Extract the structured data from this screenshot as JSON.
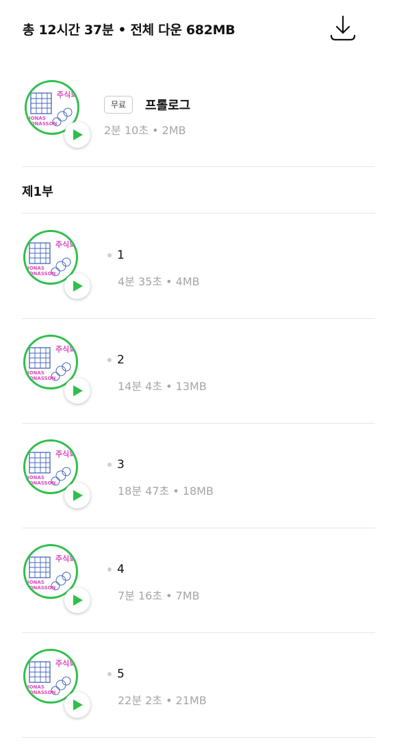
{
  "summary": {
    "text": "총 12시간 37분 • 전체 다운 682MB",
    "download_icon": "download-icon"
  },
  "prologue": {
    "badge": "무료",
    "title": "프롤로그",
    "meta": "2분 10초 • 2MB"
  },
  "section": {
    "title": "제1부"
  },
  "episodes": [
    {
      "number": "1",
      "meta": "4분 35초 • 4MB"
    },
    {
      "number": "2",
      "meta": "14분 4초 • 13MB"
    },
    {
      "number": "3",
      "meta": "18분 47초 • 18MB"
    },
    {
      "number": "4",
      "meta": "7분 16초 • 7MB"
    },
    {
      "number": "5",
      "meta": "22분 2초 • 21MB"
    }
  ],
  "cover": {
    "title_text": "주식회사",
    "author_line1": "JONAS",
    "author_line2": "JONASSON"
  },
  "colors": {
    "accent_green": "#2fbf4b",
    "cover_blue": "#3f63b8",
    "cover_pink": "#d94bbd",
    "meta_gray": "#a5a5a5"
  }
}
